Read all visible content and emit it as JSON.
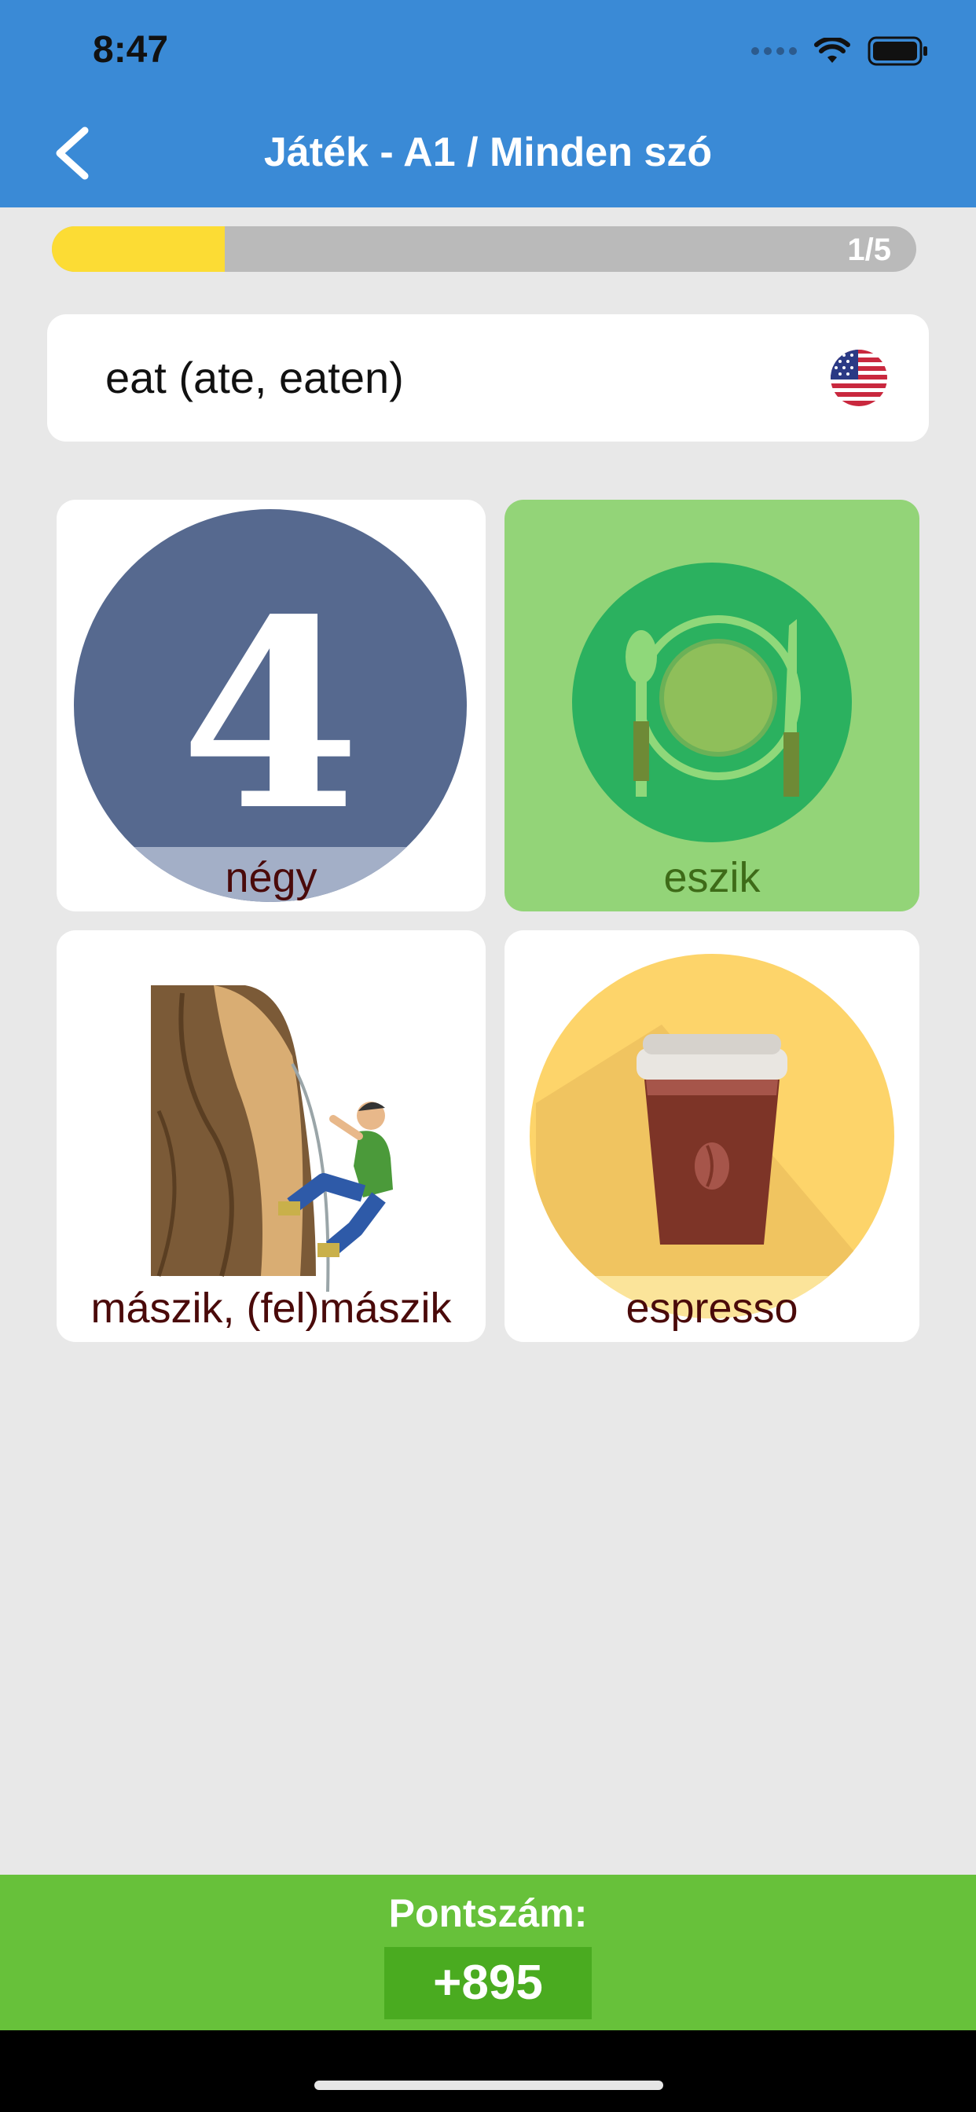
{
  "status_bar": {
    "time": "8:47"
  },
  "nav": {
    "title": "Játék - A1 / Minden szó"
  },
  "progress": {
    "label": "1/5",
    "fraction": 0.2
  },
  "prompt": {
    "text": "eat (ate, eaten)",
    "flag": "us-flag-icon"
  },
  "answers": [
    {
      "label": "négy",
      "icon": "number-four-icon",
      "selected": false
    },
    {
      "label": "eszik",
      "icon": "plate-cutlery-icon",
      "selected": true
    },
    {
      "label": "mászik, (fel)mászik",
      "icon": "climber-icon",
      "selected": false
    },
    {
      "label": "espresso",
      "icon": "coffee-cup-icon",
      "selected": false
    }
  ],
  "score": {
    "title": "Pontszám:",
    "value": "+895"
  },
  "colors": {
    "header": "#3a8ad6",
    "progress_fill": "#fcdc34",
    "selected_card": "#93d478",
    "score_bar": "#67c13a",
    "score_box": "#4aab20"
  }
}
